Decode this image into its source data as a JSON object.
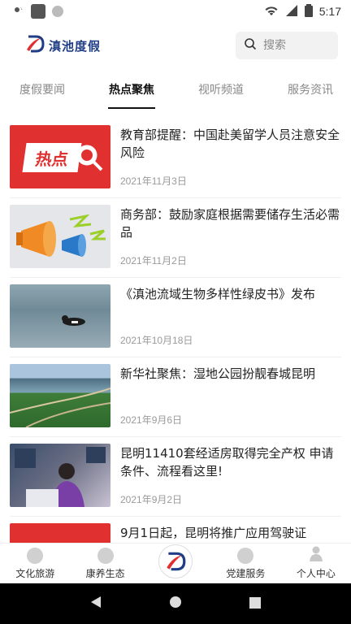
{
  "status_bar": {
    "time": "5:17"
  },
  "header": {
    "logo_text": "滇池度假",
    "search_placeholder": "搜索"
  },
  "tabs": [
    {
      "label": "度假要闻",
      "active": false
    },
    {
      "label": "热点聚焦",
      "active": true
    },
    {
      "label": "视听频道",
      "active": false
    },
    {
      "label": "服务资讯",
      "active": false
    }
  ],
  "thumb_hot_text": "热点",
  "news": [
    {
      "title": "教育部提醒：中国赴美留学人员注意安全风险",
      "date": "2021年11月3日"
    },
    {
      "title": "商务部：鼓励家庭根据需要储存生活必需品",
      "date": "2021年11月2日"
    },
    {
      "title": "《滇池流域生物多样性绿皮书》发布",
      "date": "2021年10月18日"
    },
    {
      "title": "新华社聚焦：湿地公园扮靓春城昆明",
      "date": "2021年9月6日"
    },
    {
      "title": "昆明11410套经适房取得完全产权 申请条件、流程看这里!",
      "date": "2021年9月2日"
    },
    {
      "title": "9月1日起，昆明将推广应用驾驶证",
      "date": ""
    }
  ],
  "bottom_nav": [
    {
      "label": "文化旅游"
    },
    {
      "label": "康养生态"
    },
    {
      "label": "党建服务"
    },
    {
      "label": "个人中心"
    }
  ],
  "colors": {
    "brand_blue": "#1f3e86",
    "brand_red": "#e03030"
  }
}
